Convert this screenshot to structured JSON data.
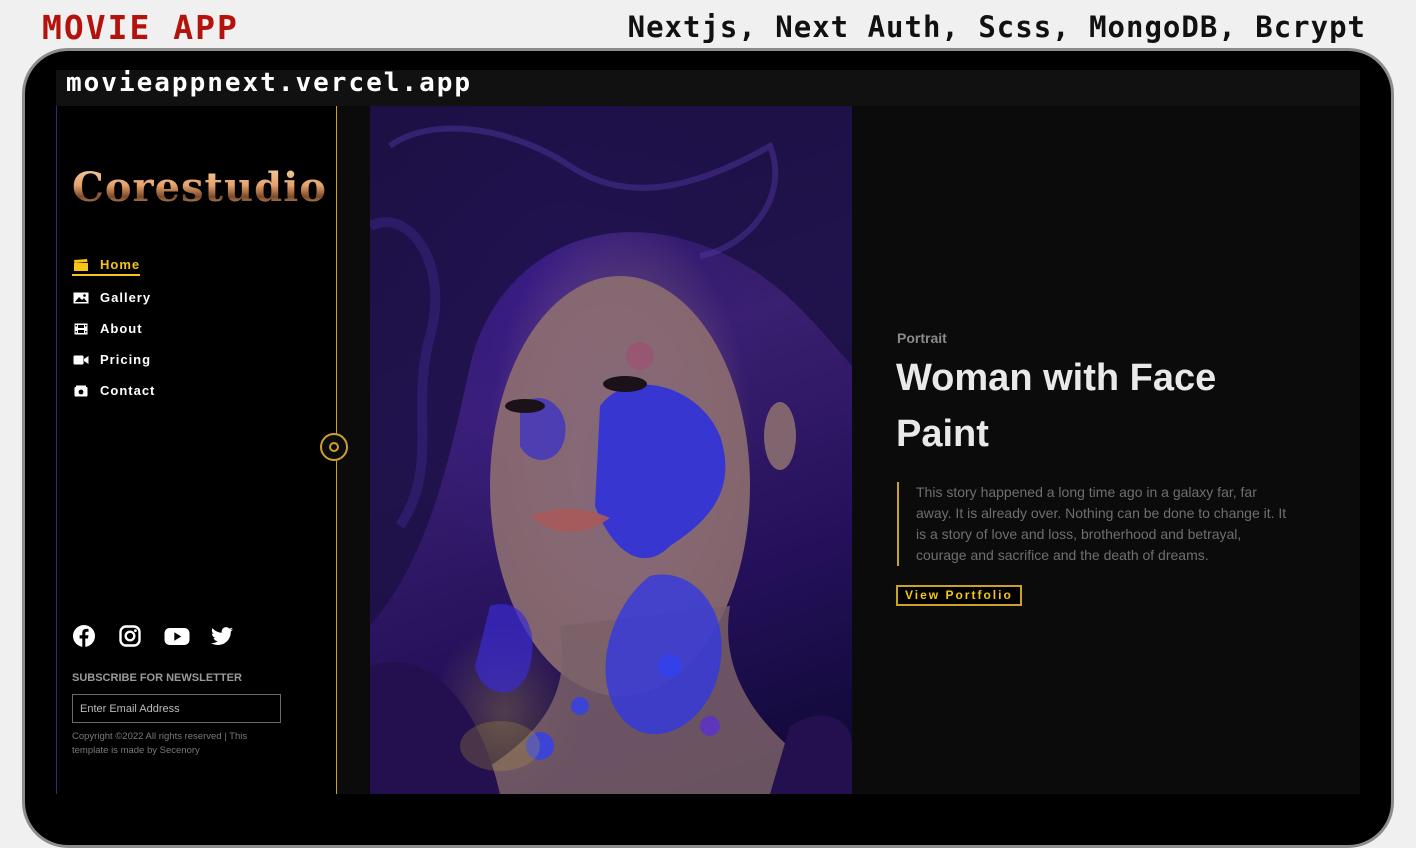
{
  "header": {
    "app_title": "MOVIE APP",
    "tech_stack": "Nextjs, Next Auth, Scss, MongoDB, Bcrypt"
  },
  "browser": {
    "url": "movieappnext.vercel.app"
  },
  "sidebar": {
    "logo": "Corestudio",
    "nav": [
      {
        "label": "Home",
        "icon": "clapperboard-icon",
        "active": true
      },
      {
        "label": "Gallery",
        "icon": "image-icon",
        "active": false
      },
      {
        "label": "About",
        "icon": "film-icon",
        "active": false
      },
      {
        "label": "Pricing",
        "icon": "video-camera-icon",
        "active": false
      },
      {
        "label": "Contact",
        "icon": "camera-icon",
        "active": false
      }
    ],
    "socials": [
      "facebook-icon",
      "instagram-icon",
      "youtube-icon",
      "twitter-icon"
    ],
    "newsletter_label": "SUBSCRIBE FOR NEWSLETTER",
    "email_placeholder": "Enter Email Address",
    "copyright": "Copyright ©2022 All rights reserved | This template is made by Secenory"
  },
  "hero": {
    "category": "Portrait",
    "title": "Woman with Face Paint",
    "description": "This story happened a long time ago in a galaxy far, far away. It is already over. Nothing can be done to change it. It is a story of love and loss, brotherhood and betrayal, courage and sacrifice and the death of dreams.",
    "button_label": "View Portfolio"
  },
  "colors": {
    "accent": "#f5c518",
    "accent_border": "#c9a227",
    "brand_red": "#b3120d",
    "background": "#0b0b0b"
  }
}
